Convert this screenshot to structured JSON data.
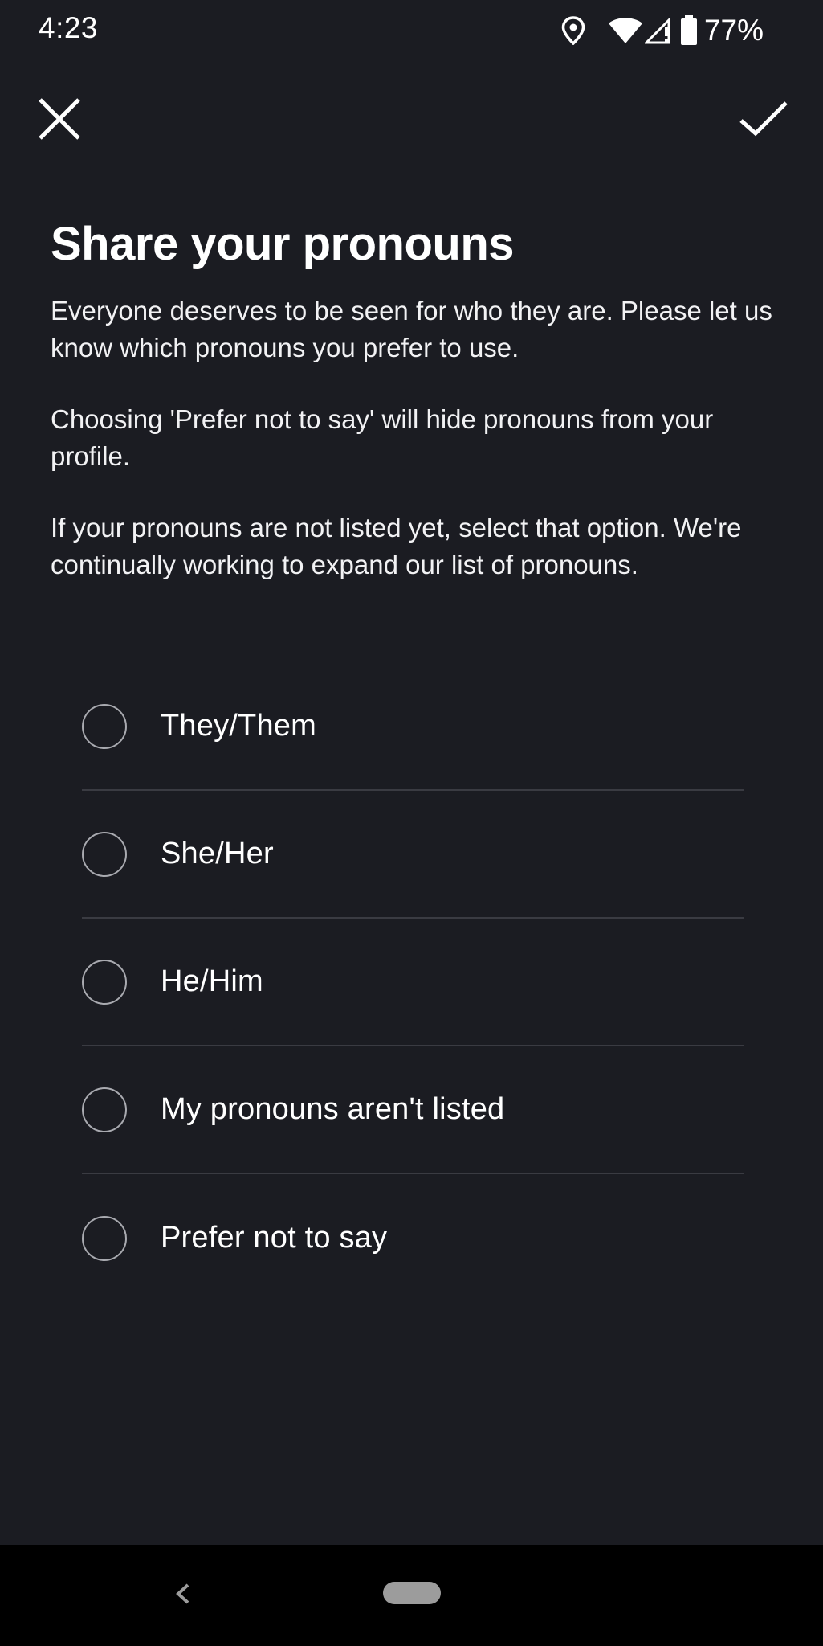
{
  "status_bar": {
    "time": "4:23",
    "battery_percent": "77%",
    "icons": [
      "location-icon",
      "wifi-icon",
      "signal-icon",
      "battery-icon"
    ]
  },
  "header": {
    "close_icon": "close-icon",
    "confirm_icon": "check-icon"
  },
  "content": {
    "title": "Share your pronouns",
    "paragraphs": [
      "Everyone deserves to be seen for who they are. Please let us know which pronouns you prefer to use.",
      "Choosing 'Prefer not to say' will hide pronouns from your profile.",
      "If your pronouns are not listed yet, select that option. We're continually working to expand our list of pronouns."
    ]
  },
  "options": [
    {
      "label": "They/Them",
      "selected": false
    },
    {
      "label": "She/Her",
      "selected": false
    },
    {
      "label": "He/Him",
      "selected": false
    },
    {
      "label": "My pronouns aren't listed",
      "selected": false
    },
    {
      "label": "Prefer not to say",
      "selected": false
    }
  ],
  "colors": {
    "background": "#1b1c22",
    "text": "#ffffff",
    "divider": "#3a3b42",
    "radio_border": "#a9aab0"
  }
}
